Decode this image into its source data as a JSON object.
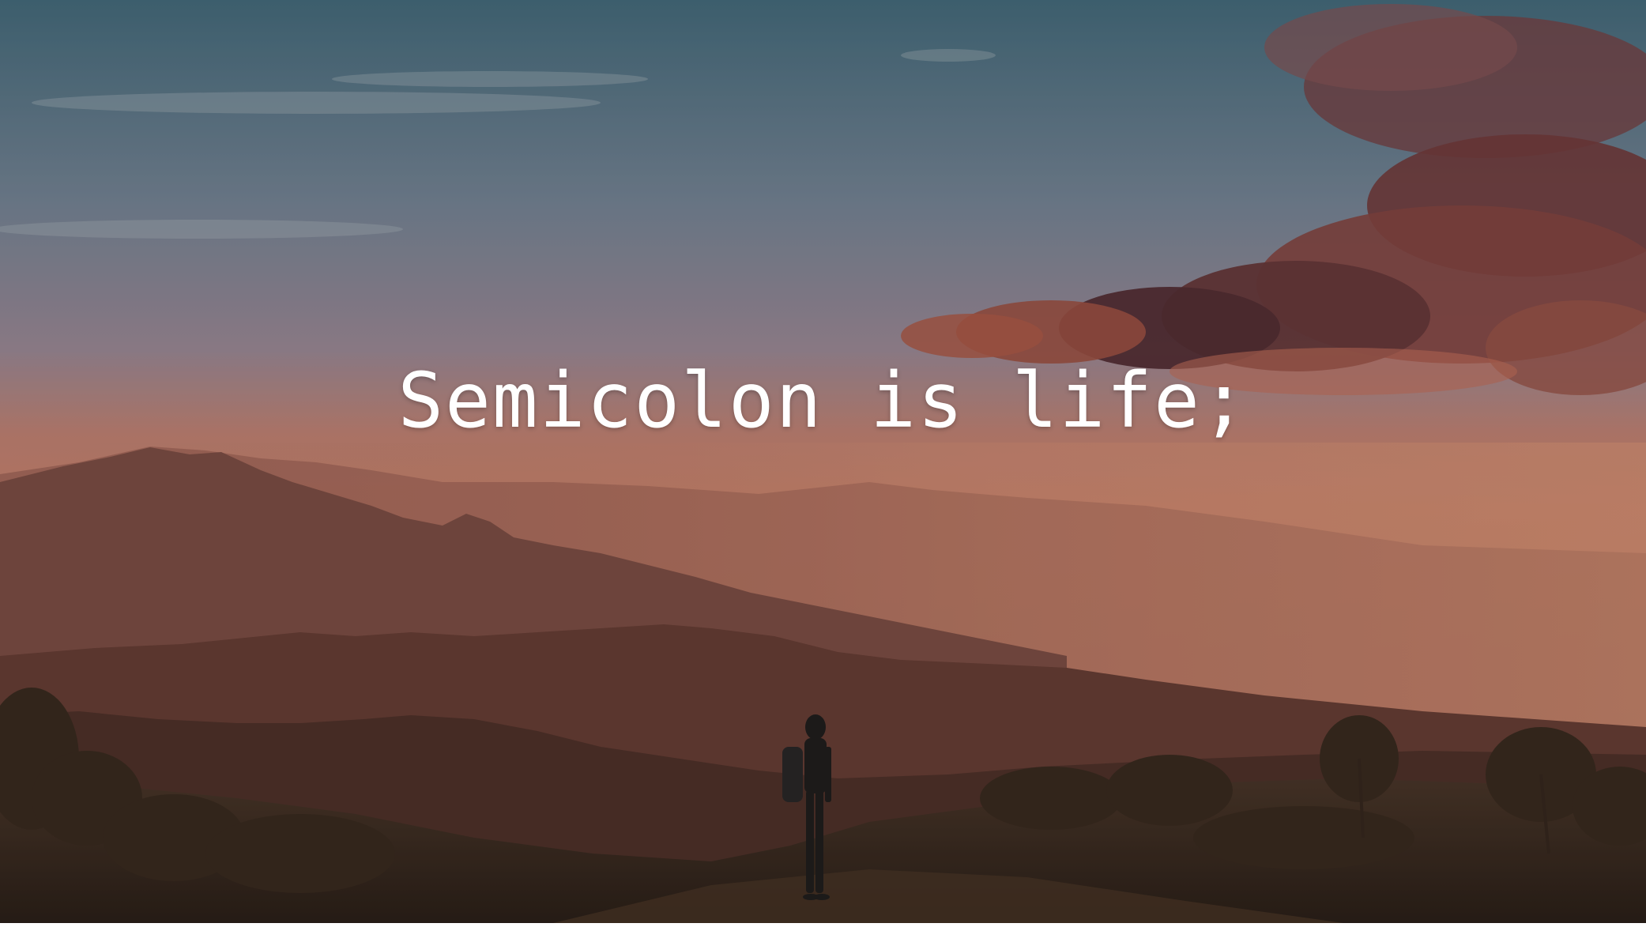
{
  "hero": {
    "headline": "Semicolon is life;"
  },
  "image": {
    "subject": "hiker-standing-on-hilltop-at-sunset",
    "palette": {
      "sky_top": "#4f7487",
      "sky_mid": "#8b8fa4",
      "horizon": "#d88a72",
      "cloud": "#8a4a48",
      "mountain_far": "#b2735f",
      "mountain_mid": "#7a4a40",
      "mountain_near": "#4a3029",
      "ground": "#3a2a20"
    }
  }
}
